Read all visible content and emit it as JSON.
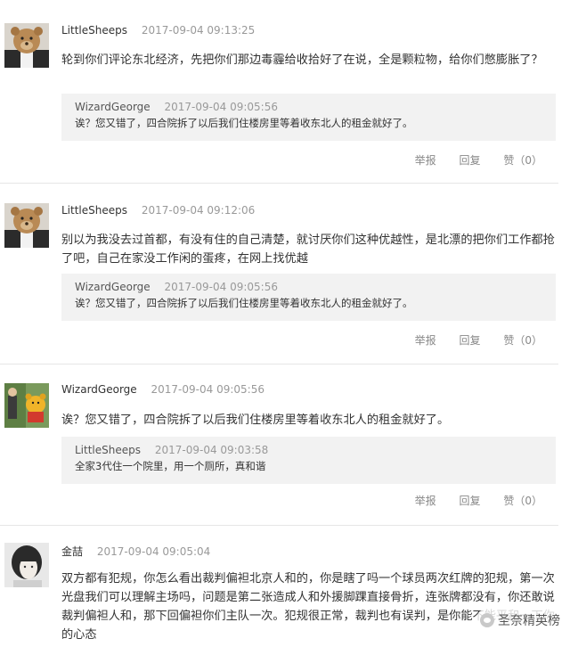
{
  "comments": [
    {
      "author": "LittleSheeps",
      "time": "2017-09-04 09:13:25",
      "avatar_icon": "teddy-bear-avatar",
      "text": "轮到你们评论东北经济，先把你们那边毒霾给收拾好了在说，全是颗粒物，给你们憋膨胀了？",
      "quote": {
        "author": "WizardGeorge",
        "time": "2017-09-04 09:05:56",
        "text": "诶？您又错了，四合院拆了以后我们住楼房里等着收东北人的租金就好了。"
      },
      "actions": {
        "report": "举报",
        "reply": "回复",
        "like": "赞（0）"
      }
    },
    {
      "author": "LittleSheeps",
      "time": "2017-09-04 09:12:06",
      "avatar_icon": "teddy-bear-avatar",
      "text": "别以为我没去过首都，有没有住的自己清楚，就讨厌你们这种优越性，是北漂的把你们工作都抢了吧，自己在家没工作闲的蛋疼，在网上找优越",
      "quote": {
        "author": "WizardGeorge",
        "time": "2017-09-04 09:05:56",
        "text": "诶？您又错了，四合院拆了以后我们住楼房里等着收东北人的租金就好了。"
      },
      "actions": {
        "report": "举报",
        "reply": "回复",
        "like": "赞（0）"
      }
    },
    {
      "author": "WizardGeorge",
      "time": "2017-09-04 09:05:56",
      "avatar_icon": "cartoon-bear-avatar",
      "text": "诶？您又错了，四合院拆了以后我们住楼房里等着收东北人的租金就好了。",
      "quote": {
        "author": "LittleSheeps",
        "time": "2017-09-04 09:03:58",
        "text": "全家3代住一个院里，用一个厕所，真和谐"
      },
      "actions": {
        "report": "举报",
        "reply": "回复",
        "like": "赞（0）"
      }
    },
    {
      "author": "金喆",
      "time": "2017-09-04 09:05:04",
      "avatar_icon": "person-portrait-avatar",
      "text": "双方都有犯规，你怎么看出裁判偏袒北京人和的，你是瞎了吗一个球员两次红牌的犯规，第一次光盘我们可以理解主场吗，问题是第二张造成人和外援脚踝直接骨折，连张牌都没有，你还敢说裁判偏袒人和，那下回偏袒你们主队一次。犯规很正常，裁判也有误判，是你能不能平和一下你的心态"
    }
  ],
  "watermark": {
    "text": "圣奈精英榜",
    "icon": "wechat-icon"
  }
}
